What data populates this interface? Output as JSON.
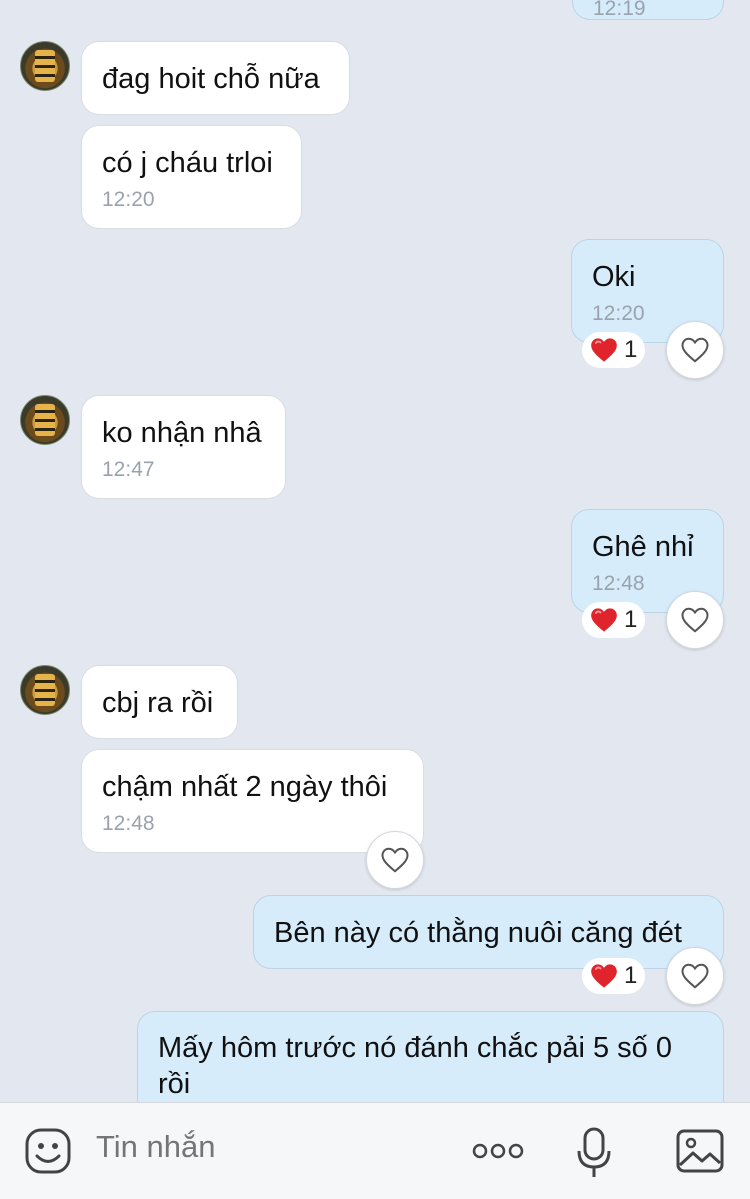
{
  "messages": [
    {
      "text": "12:19"
    },
    {
      "text": "đag hoit chỗ nữa"
    },
    {
      "text": "có j cháu trloi",
      "time": "12:20"
    },
    {
      "text": "Oki",
      "time": "12:20",
      "reaction_count": "1"
    },
    {
      "text": "ko nhận nhâ",
      "time": "12:47"
    },
    {
      "text": "Ghê nhỉ",
      "time": "12:48",
      "reaction_count": "1"
    },
    {
      "text": "cbj ra rồi"
    },
    {
      "text": "chậm nhất 2 ngày thôi",
      "time": "12:48"
    },
    {
      "text": "Bên này có thằng nuôi căng đét",
      "reaction_count": "1"
    },
    {
      "text": "Mấy hôm trước nó đánh chắc pải 5 số 0 rồi"
    }
  ],
  "composer": {
    "placeholder": "Tin nhắn"
  },
  "icons": {
    "emoji": "emoji-icon",
    "more": "more-icon",
    "mic": "microphone-icon",
    "image": "image-icon",
    "heart_outline": "heart-outline-icon",
    "heart_filled": "heart-filled-icon"
  },
  "colors": {
    "background": "#e3e8f0",
    "incoming": "#ffffff",
    "outgoing": "#d6ecfb",
    "heart": "#e0242c"
  }
}
